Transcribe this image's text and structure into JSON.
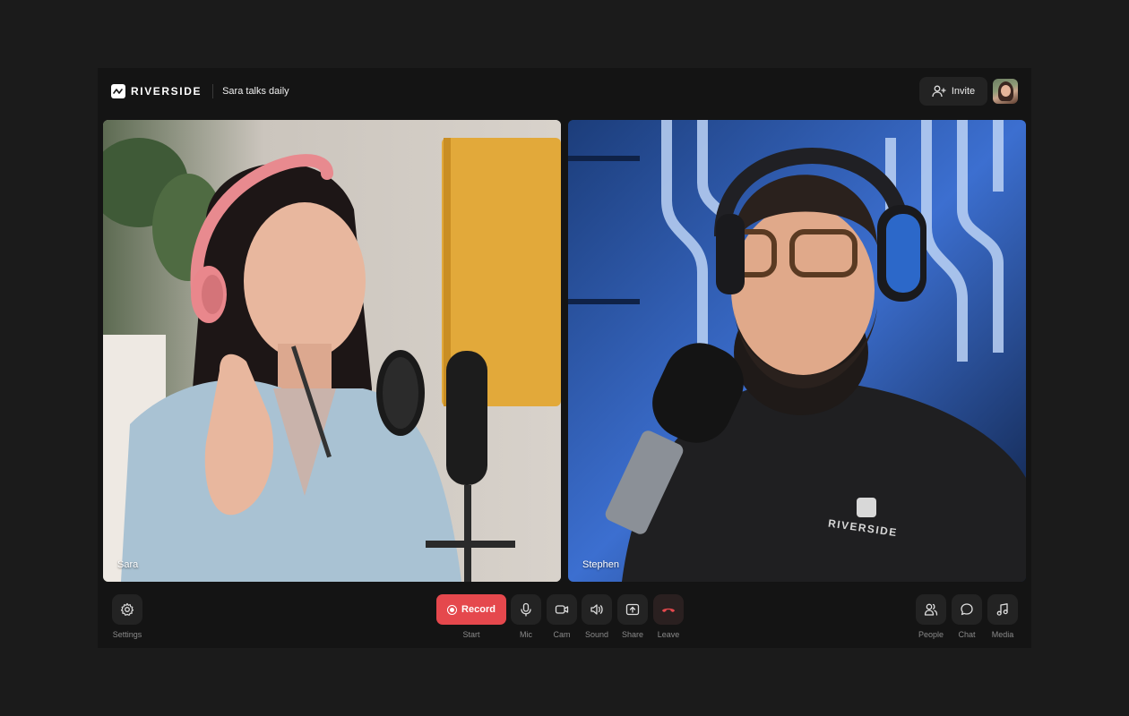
{
  "brand": {
    "name": "RIVERSIDE",
    "logo_icon": "riverside-wave-icon"
  },
  "session": {
    "title": "Sara talks daily"
  },
  "header": {
    "invite_label": "Invite",
    "invite_icon": "add-user-icon",
    "avatar_icon": "user-avatar"
  },
  "participants": [
    {
      "name": "Sara"
    },
    {
      "name": "Stephen",
      "shirt_text": "RIVERSIDE"
    }
  ],
  "controls": {
    "settings": {
      "label": "Settings",
      "icon": "gear-icon"
    },
    "record": {
      "button_label": "Record",
      "label": "Start",
      "icon": "record-icon"
    },
    "mic": {
      "label": "Mic",
      "icon": "microphone-icon"
    },
    "cam": {
      "label": "Cam",
      "icon": "camera-icon"
    },
    "sound": {
      "label": "Sound",
      "icon": "speaker-icon"
    },
    "share": {
      "label": "Share",
      "icon": "share-screen-icon"
    },
    "leave": {
      "label": "Leave",
      "icon": "phone-hangup-icon"
    },
    "people": {
      "label": "People",
      "icon": "people-icon"
    },
    "chat": {
      "label": "Chat",
      "icon": "chat-bubble-icon"
    },
    "media": {
      "label": "Media",
      "icon": "music-note-icon"
    }
  },
  "colors": {
    "record": "#e5484d",
    "leave_icon": "#e5484d",
    "background": "#1b1b1b",
    "panel": "#141414",
    "button": "#232323"
  }
}
